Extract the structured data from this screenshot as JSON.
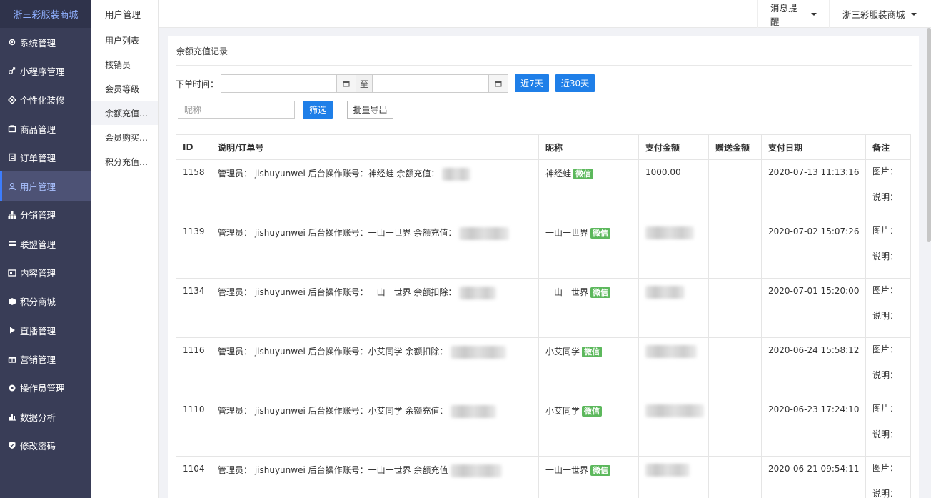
{
  "brand": "浙三彩服装商城",
  "sidebar": {
    "items": [
      {
        "label": "系统管理",
        "icon": "gear-icon"
      },
      {
        "label": "小程序管理",
        "icon": "link-icon"
      },
      {
        "label": "个性化装修",
        "icon": "palette-icon"
      },
      {
        "label": "商品管理",
        "icon": "bag-icon"
      },
      {
        "label": "订单管理",
        "icon": "clipboard-icon"
      },
      {
        "label": "用户管理",
        "icon": "user-icon"
      },
      {
        "label": "分销管理",
        "icon": "sitemap-icon"
      },
      {
        "label": "联盟管理",
        "icon": "card-icon"
      },
      {
        "label": "内容管理",
        "icon": "newspaper-icon"
      },
      {
        "label": "积分商城",
        "icon": "cube-icon"
      },
      {
        "label": "直播管理",
        "icon": "play-icon"
      },
      {
        "label": "营销管理",
        "icon": "gift-icon"
      },
      {
        "label": "操作员管理",
        "icon": "cog-icon"
      },
      {
        "label": "数据分析",
        "icon": "bar-chart-icon"
      },
      {
        "label": "修改密码",
        "icon": "shield-icon"
      }
    ],
    "active_index": 5
  },
  "subbar": {
    "title": "用户管理",
    "items": [
      "用户列表",
      "核销员",
      "会员等级",
      "余额充值…",
      "会员购买…",
      "积分充值…"
    ],
    "active_index": 3
  },
  "topbar": {
    "notifications": "消息提醒",
    "store": "浙三彩服装商城"
  },
  "panel": {
    "title": "余额充值记录",
    "filter": {
      "time_label": "下单时间：",
      "to_label": "至",
      "last7": "近7天",
      "last30": "近30天",
      "nickname_placeholder": "昵称",
      "filter_btn": "筛选",
      "export_btn": "批量导出"
    },
    "table": {
      "headers": [
        "ID",
        "说明/订单号",
        "昵称",
        "支付金额",
        "赠送金额",
        "支付日期",
        "备注"
      ],
      "rows": [
        {
          "id": "1158",
          "desc": "管理员： jishuyunwei 后台操作账号：神经蛙 余额充值：",
          "nick": "神经蛙",
          "pay": "1000.00",
          "gift": "",
          "date": "2020-07-13 11:13:16"
        },
        {
          "id": "1139",
          "desc": "管理员： jishuyunwei 后台操作账号：一山一世界 余额充值：",
          "nick": "一山一世界",
          "pay": "",
          "gift": "",
          "date": "2020-07-02 15:07:26"
        },
        {
          "id": "1134",
          "desc": "管理员： jishuyunwei 后台操作账号：一山一世界 余额扣除：",
          "nick": "一山一世界",
          "pay": "",
          "gift": "",
          "date": "2020-07-01 15:20:00"
        },
        {
          "id": "1116",
          "desc": "管理员： jishuyunwei 后台操作账号：小艾同学 余额扣除：",
          "nick": "小艾同学",
          "pay": "",
          "gift": "",
          "date": "2020-06-24 15:58:12"
        },
        {
          "id": "1110",
          "desc": "管理员： jishuyunwei 后台操作账号：小艾同学 余额充值：",
          "nick": "小艾同学",
          "pay": "",
          "gift": "",
          "date": "2020-06-23 17:24:10"
        },
        {
          "id": "1104",
          "desc": "管理员： jishuyunwei 后台操作账号：一山一世界 余额充值",
          "nick": "一山一世界",
          "pay": "",
          "gift": "",
          "date": "2020-06-21 09:54:11"
        }
      ],
      "badge": "微信",
      "remark_image": "图片：",
      "remark_note": "说明："
    }
  }
}
